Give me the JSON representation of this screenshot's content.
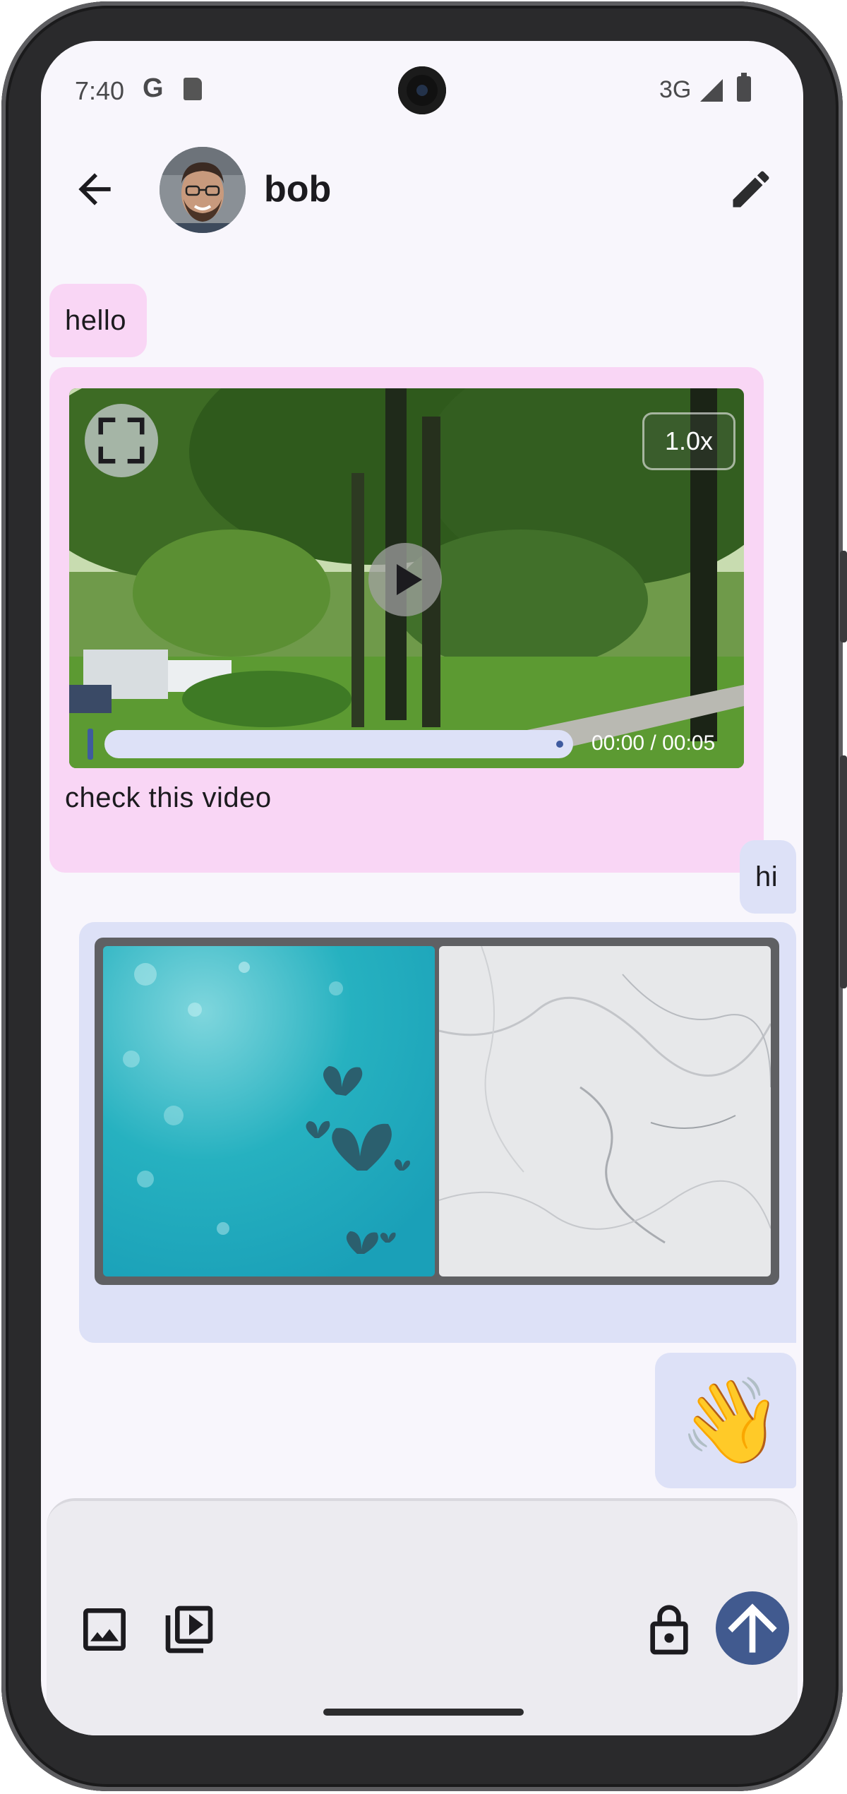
{
  "status_bar": {
    "time": "7:40",
    "google_icon": "G",
    "network": "3G",
    "icons": [
      "google-icon",
      "sd-card-icon",
      "signal-icon",
      "battery-icon"
    ]
  },
  "appbar": {
    "contact_name": "bob",
    "back_icon": "arrow-back-icon",
    "edit_icon": "edit-pencil-icon"
  },
  "messages": [
    {
      "direction": "incoming",
      "type": "text",
      "text": "hello"
    },
    {
      "direction": "incoming",
      "type": "video",
      "caption": "check this video",
      "speed": "1.0x",
      "time": "00:00 / 00:05",
      "progress": 0.0
    },
    {
      "direction": "outgoing",
      "type": "text",
      "text": "hi"
    },
    {
      "direction": "outgoing",
      "type": "image-collage",
      "images": [
        "teal-butterflies-image",
        "white-marble-image"
      ]
    },
    {
      "direction": "outgoing",
      "type": "emoji",
      "text": "👋"
    }
  ],
  "composer": {
    "buttons": [
      "image-icon",
      "video-library-icon",
      "lock-icon",
      "send-arrow-icon"
    ]
  },
  "colors": {
    "incoming_bubble": "#f9d6f5",
    "outgoing_bubble": "#dde1f7",
    "send_button": "#415a8f",
    "background": "#f8f6fc"
  }
}
